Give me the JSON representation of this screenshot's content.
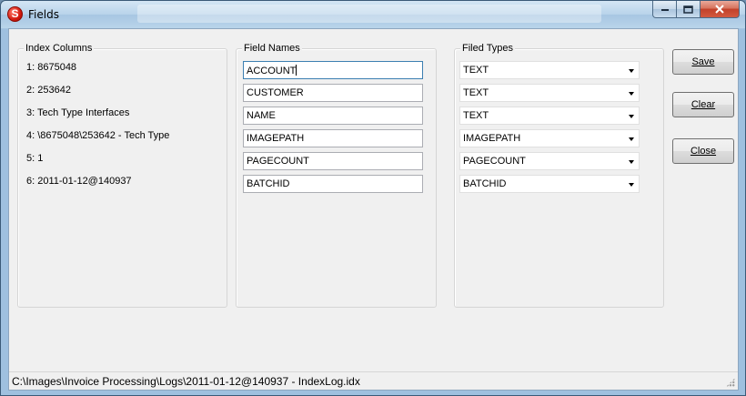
{
  "window": {
    "title": "Fields",
    "icon_letter": "S"
  },
  "index_columns": {
    "title": "Index Columns",
    "items": [
      "1: 8675048",
      "2: 253642",
      "3: Tech Type Interfaces",
      "4: \\8675048\\253642 - Tech Type",
      "5: 1",
      "6: 2011-01-12@140937"
    ]
  },
  "field_names": {
    "title": "Field Names",
    "values": [
      "ACCOUNT",
      "CUSTOMER",
      "NAME",
      "IMAGEPATH",
      "PAGECOUNT",
      "BATCHID"
    ]
  },
  "field_types": {
    "title": "Filed Types",
    "values": [
      "TEXT",
      "TEXT",
      "TEXT",
      "IMAGEPATH",
      "PAGECOUNT",
      "BATCHID"
    ]
  },
  "buttons": {
    "save": "Save",
    "clear": "Clear",
    "close": "Close"
  },
  "status": {
    "path": "C:\\Images\\Invoice Processing\\Logs\\2011-01-12@140937 - IndexLog.idx"
  },
  "icons": {
    "minimize": "minimize-icon",
    "maximize": "maximize-icon",
    "close": "close-icon",
    "app": "app-logo-icon",
    "dropdown": "chevron-down-icon",
    "grip": "resize-grip-icon"
  }
}
